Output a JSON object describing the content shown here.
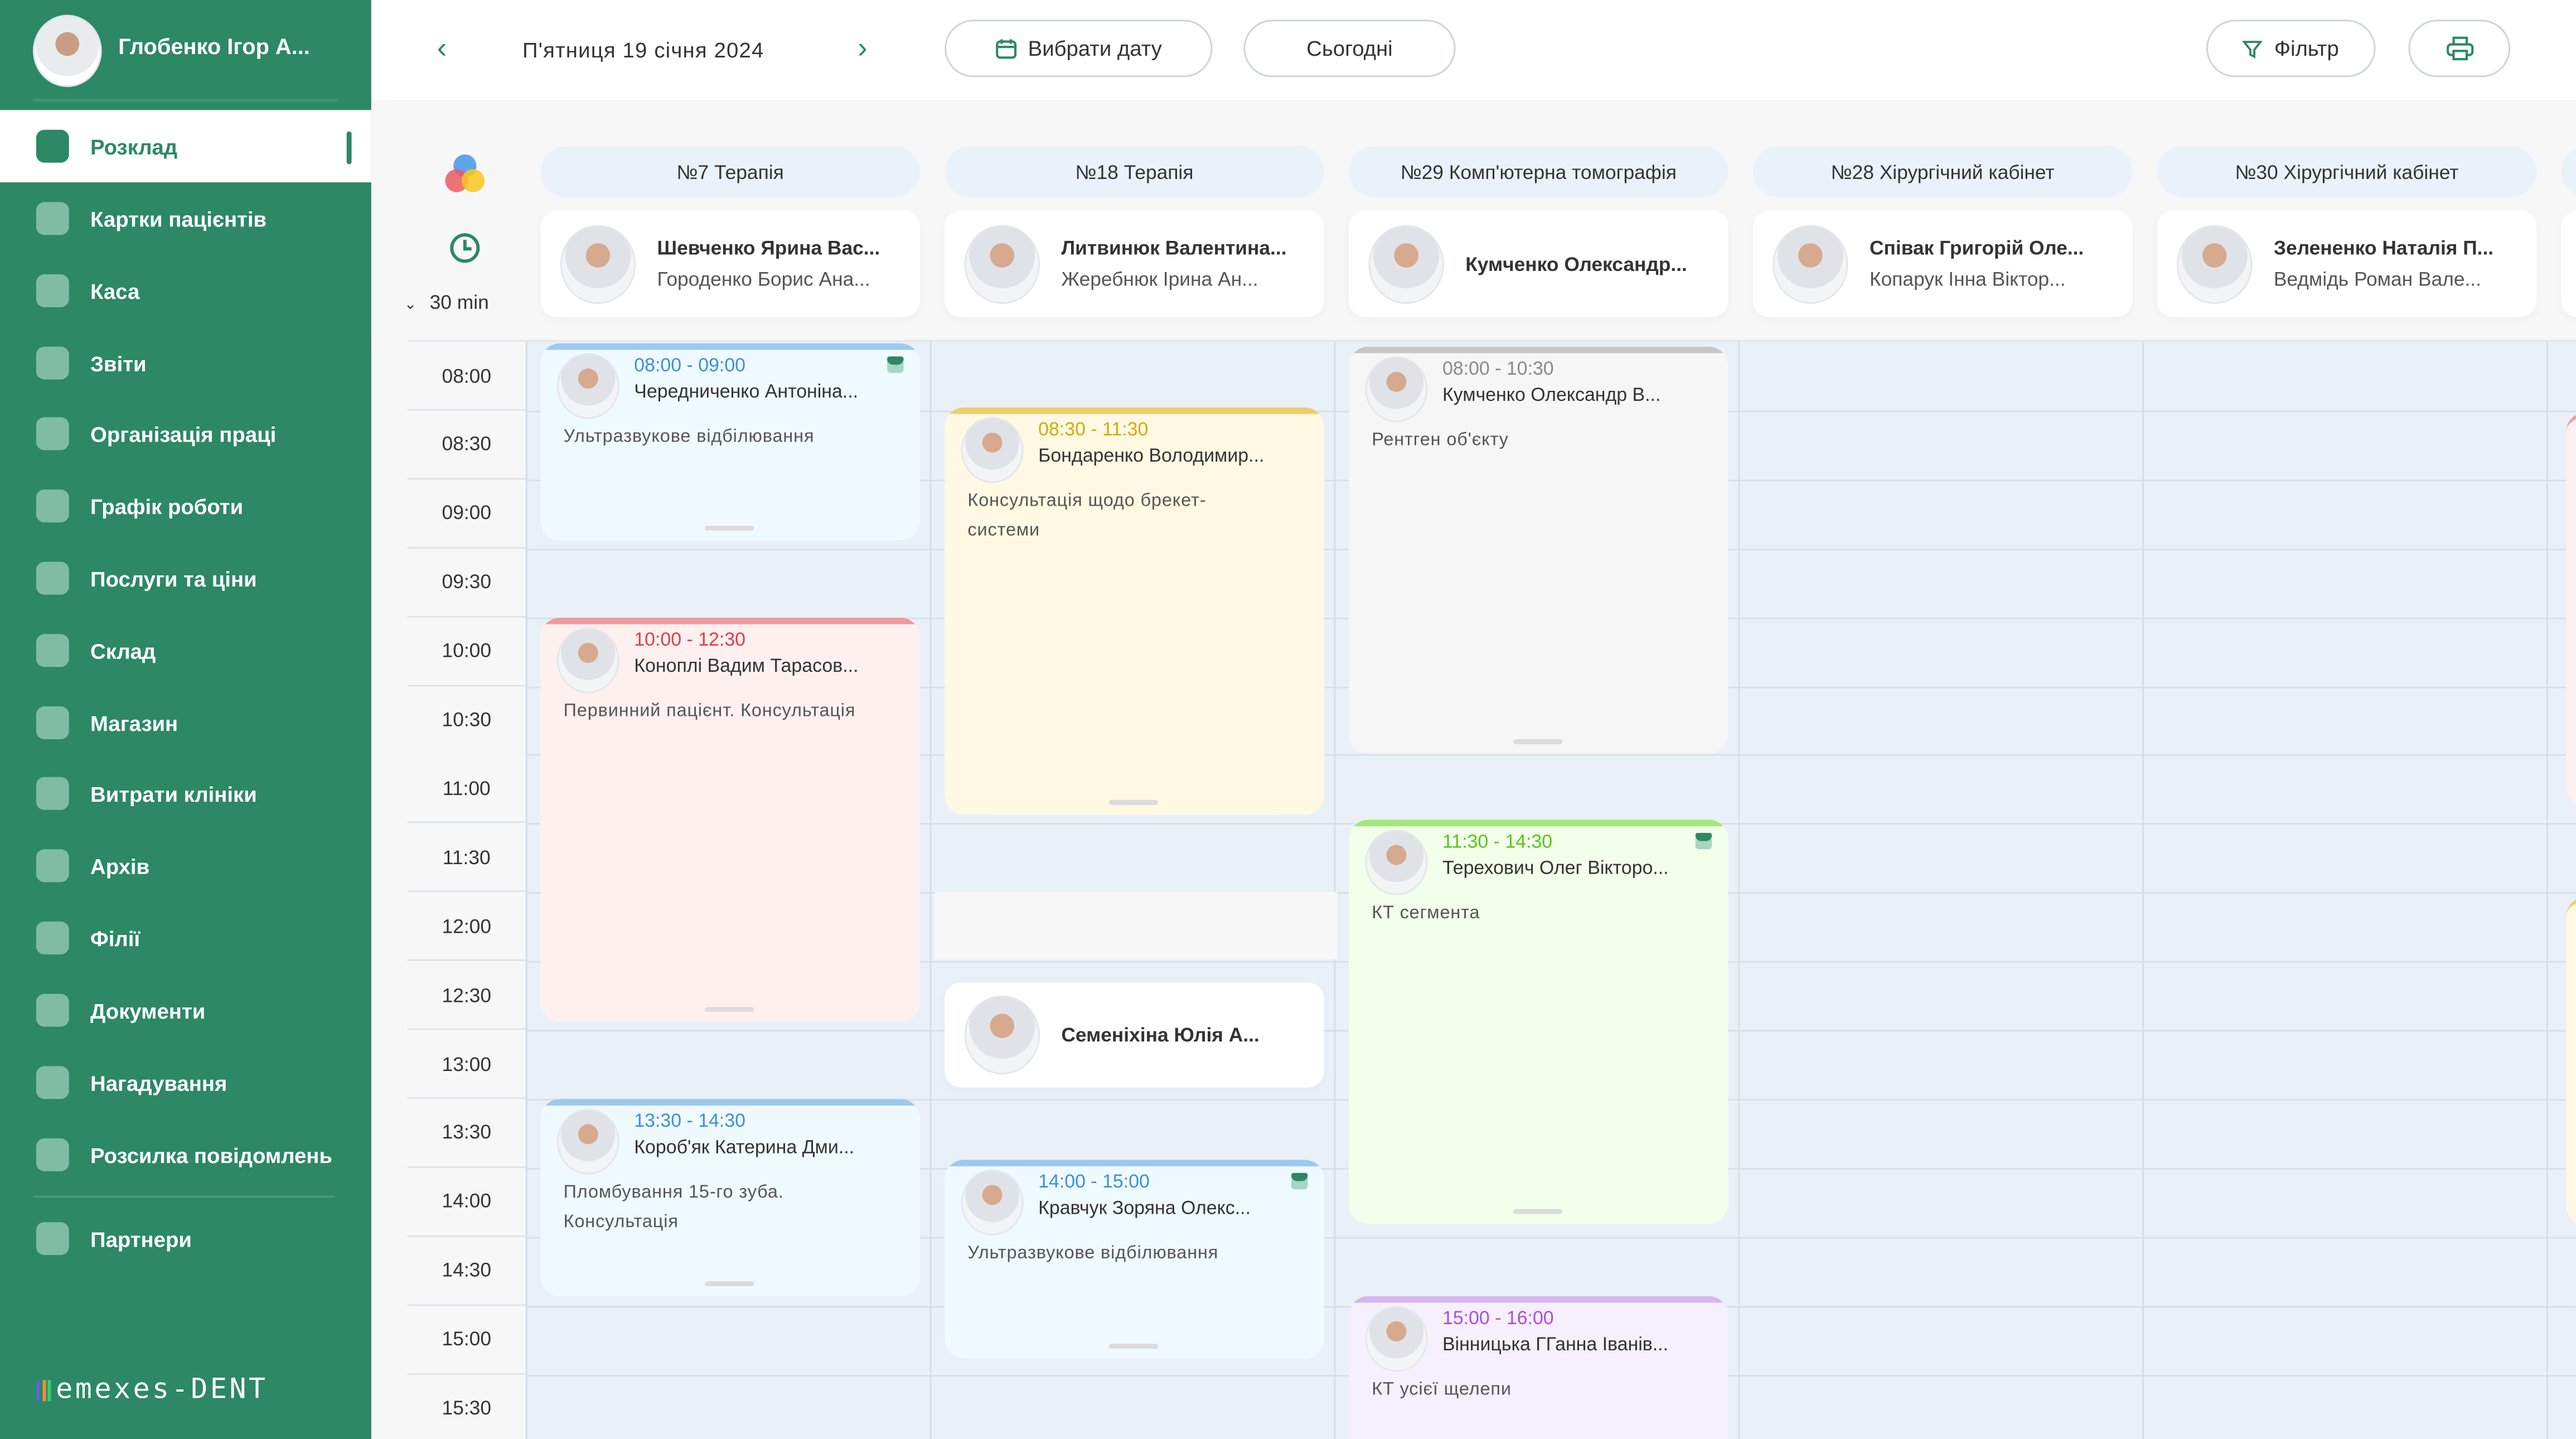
{
  "user": {
    "name": "Глобенко Ігор А..."
  },
  "sidebar": {
    "items": [
      {
        "label": "Розклад",
        "icon": "schedule-icon",
        "active": true
      },
      {
        "label": "Картки пацієнтів",
        "icon": "patients-icon"
      },
      {
        "label": "Каса",
        "icon": "wallet-icon"
      },
      {
        "label": "Звіти",
        "icon": "reports-icon"
      },
      {
        "label": "Організація праці",
        "icon": "briefcase-icon"
      },
      {
        "label": "Графік роботи",
        "icon": "calendar-icon"
      },
      {
        "label": "Послуги та ціни",
        "icon": "chart-icon"
      },
      {
        "label": "Склад",
        "icon": "cart-icon"
      },
      {
        "label": "Магазин",
        "icon": "bag-icon"
      },
      {
        "label": "Витрати клініки",
        "icon": "bar-chart-icon"
      },
      {
        "label": "Архів",
        "icon": "archive-icon"
      },
      {
        "label": "Філії",
        "icon": "home-icon"
      },
      {
        "label": "Документи",
        "icon": "document-icon"
      },
      {
        "label": "Нагадування",
        "icon": "bell-icon"
      },
      {
        "label": "Розсилка повідомлень",
        "icon": "mail-icon"
      },
      {
        "label": "Партнери",
        "icon": "star-icon"
      }
    ],
    "logo": "emexes-DENT"
  },
  "topbar": {
    "date": "П'ятниця 19 січня 2024",
    "pick_date": "Вибрати дату",
    "today": "Сьогодні",
    "filter": "Фільтр"
  },
  "interval": "30 min",
  "times": [
    "08:00",
    "08:30",
    "09:00",
    "09:30",
    "10:00",
    "10:30",
    "11:00",
    "11:30",
    "12:00",
    "12:30",
    "13:00",
    "13:30",
    "14:00",
    "14:30",
    "15:00",
    "15:30"
  ],
  "columns": [
    {
      "room": "№7 Терапія",
      "doctor": "Шевченко Ярина Вас...",
      "assistant": "Городенко Борис Ана..."
    },
    {
      "room": "№18 Терапія",
      "doctor": "Литвинюк Валентина...",
      "assistant": "Жеребнюк Ірина Ан..."
    },
    {
      "room": "№29 Комп'ютерна томографія",
      "doctor": "Кумченко Олександр...",
      "assistant": ""
    },
    {
      "room": "№28 Хірургічний кабінет",
      "doctor": "Співак Григорій Оле...",
      "assistant": "Копарук Інна Віктор..."
    },
    {
      "room": "№30 Хірургічний кабінет",
      "doctor": "Зелененко Наталія П...",
      "assistant": "Ведмідь Роман Вале..."
    }
  ],
  "shift_doctor": {
    "name": "Семеніхіна Юлія А..."
  },
  "colors": {
    "blue": {
      "bar": "#9cc9ef",
      "bg": "#effaff",
      "time": "#3b8fe0"
    },
    "red": {
      "bar": "#f0999e",
      "bg": "#fff0f0",
      "time": "#e23b46"
    },
    "yellow": {
      "bar": "#ebcf6d",
      "bg": "#fff9e4",
      "time": "#d6a900"
    },
    "grey": {
      "bar": "#c6c6c6",
      "bg": "#f6f6f6",
      "time": "#8a8a8a"
    },
    "green": {
      "bar": "#a2e876",
      "bg": "#f2ffea",
      "time": "#5ac51c"
    },
    "purple": {
      "bar": "#d7b6ee",
      "bg": "#f6effe",
      "time": "#a652d6"
    }
  },
  "appointments": [
    {
      "column": 0,
      "time": "08:00 - 09:00",
      "patient": "Чередниченко Антоніна...",
      "service": "Ультразвукове відбілювання",
      "color": "blue",
      "confirmed": true
    },
    {
      "column": 0,
      "time": "10:00 - 12:30",
      "patient": "Коноплі Вадим Тарасов...",
      "service": "Первинний пацієнт. Консультація",
      "color": "red",
      "confirmed": false
    },
    {
      "column": 0,
      "time": "13:30 - 14:30",
      "patient": "Короб'як Катерина Дми...",
      "service": "Пломбування 15-го зуба. Консультація",
      "color": "blue",
      "confirmed": false
    },
    {
      "column": 1,
      "time": "08:30 - 11:30",
      "patient": "Бондаренко Володимир...",
      "service": "Консультація щодо брекет-системи",
      "color": "yellow",
      "confirmed": false
    },
    {
      "column": 1,
      "time": "14:00 - 15:00",
      "patient": "Кравчук Зоряна Олекс...",
      "service": "Ультразвукове відбілювання",
      "color": "blue",
      "confirmed": true
    },
    {
      "column": 2,
      "time": "08:00 - 10:30",
      "patient": "Кумченко Олександр В...",
      "service": "Рентген об'єкту",
      "color": "grey",
      "confirmed": false
    },
    {
      "column": 2,
      "time": "11:30 - 14:30",
      "patient": "Терехович Олег Вікторо...",
      "service": "КТ сегмента",
      "color": "green",
      "confirmed": true
    },
    {
      "column": 2,
      "time": "15:00 - 16:00",
      "patient": "Вінницька ГГанна Іванів...",
      "service": "КТ усієї щелепи",
      "color": "purple",
      "confirmed": false
    }
  ]
}
